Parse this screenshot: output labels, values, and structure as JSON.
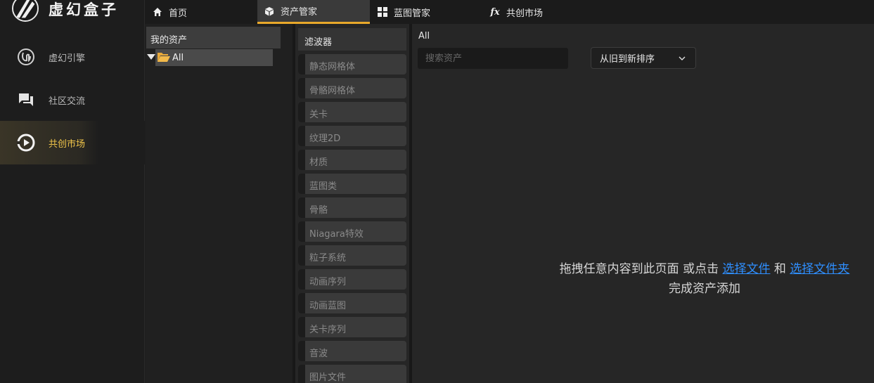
{
  "app": {
    "title": "虚幻盒子"
  },
  "sidebar": {
    "items": [
      {
        "label": "虚幻引擎",
        "icon": "unreal-engine-icon"
      },
      {
        "label": "社区交流",
        "icon": "chat-icon"
      },
      {
        "label": "共创市场",
        "icon": "market-icon",
        "active": true
      }
    ]
  },
  "topbar": {
    "tabs": [
      {
        "label": "首页",
        "icon": "home-icon"
      },
      {
        "label": "资产管家",
        "icon": "cube-icon",
        "active": true
      },
      {
        "label": "蓝图管家",
        "icon": "grid-icon"
      },
      {
        "label": "共创市场",
        "icon": "fx-icon",
        "icon_text": "fx"
      }
    ]
  },
  "tree": {
    "header": "我的资产",
    "root": {
      "label": "All",
      "expanded": true,
      "selected": true
    }
  },
  "filters": {
    "header": "滤波器",
    "items": [
      "静态网格体",
      "骨骼网格体",
      "关卡",
      "纹理2D",
      "材质",
      "蓝图类",
      "骨骼",
      "Niagara特效",
      "粒子系统",
      "动画序列",
      "动画蓝图",
      "关卡序列",
      "音波",
      "图片文件"
    ]
  },
  "main": {
    "breadcrumb": "All",
    "search_placeholder": "搜索资产",
    "sort_label": "从旧到新排序",
    "drop": {
      "prefix": "拖拽任意内容到此页面 或点击 ",
      "link_file": "选择文件",
      "middle": " 和 ",
      "link_folder": "选择文件夹",
      "suffix": " 完成资产添加"
    }
  },
  "colors": {
    "accent": "#e9a92a",
    "active_nav_text": "#f0c44a",
    "link": "#2f8fff",
    "folder": "#e8a93a"
  }
}
